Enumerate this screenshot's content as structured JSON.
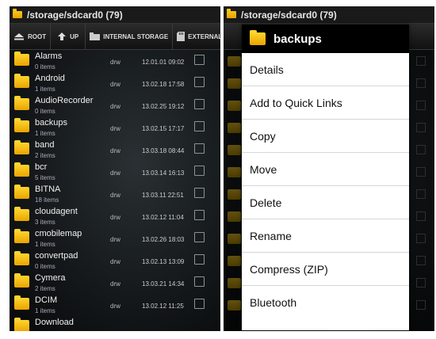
{
  "left_screen": {
    "path_title": "/storage/sdcard0  (79)",
    "toolbar": {
      "root_label": "ROOT",
      "up_label": "UP",
      "internal_label": "INTERNAL STORAGE",
      "external_label": "EXTERNAL"
    },
    "folders": [
      {
        "name": "Alarms",
        "count": "0 items",
        "perm": "drw",
        "date": "12.01.01 09:02"
      },
      {
        "name": "Android",
        "count": "1 items",
        "perm": "drw",
        "date": "13.02.18 17:58"
      },
      {
        "name": "AudioRecorder",
        "count": "0 items",
        "perm": "drw",
        "date": "13.02.25 19:12"
      },
      {
        "name": "backups",
        "count": "1 items",
        "perm": "drw",
        "date": "13.02.15 17:17"
      },
      {
        "name": "band",
        "count": "2 items",
        "perm": "drw",
        "date": "13.03.18 08:44"
      },
      {
        "name": "bcr",
        "count": "5 items",
        "perm": "drw",
        "date": "13.03.14 16:13"
      },
      {
        "name": "BITNA",
        "count": "18 items",
        "perm": "drw",
        "date": "13.03.11 22:51"
      },
      {
        "name": "cloudagent",
        "count": "3 items",
        "perm": "drw",
        "date": "13.02.12 11:04"
      },
      {
        "name": "cmobilemap",
        "count": "1 items",
        "perm": "drw",
        "date": "13.02.26 18:03"
      },
      {
        "name": "convertpad",
        "count": "0 items",
        "perm": "drw",
        "date": "13.02.13 13:09"
      },
      {
        "name": "Cymera",
        "count": "2 items",
        "perm": "drw",
        "date": "13.03.21 14:34"
      },
      {
        "name": "DCIM",
        "count": "1 items",
        "perm": "drw",
        "date": "13.02.12 11:25"
      },
      {
        "name": "Download",
        "count": "",
        "perm": "",
        "date": ""
      }
    ]
  },
  "right_screen": {
    "path_title": "/storage/sdcard0  (79)",
    "context_menu": {
      "title": "backups",
      "items": [
        "Details",
        "Add to Quick Links",
        "Copy",
        "Move",
        "Delete",
        "Rename",
        "Compress (ZIP)",
        "Bluetooth"
      ]
    }
  },
  "colors": {
    "folder_yellow": "#f5b800",
    "menu_background": "#ffffff",
    "header_background": "#000000"
  }
}
